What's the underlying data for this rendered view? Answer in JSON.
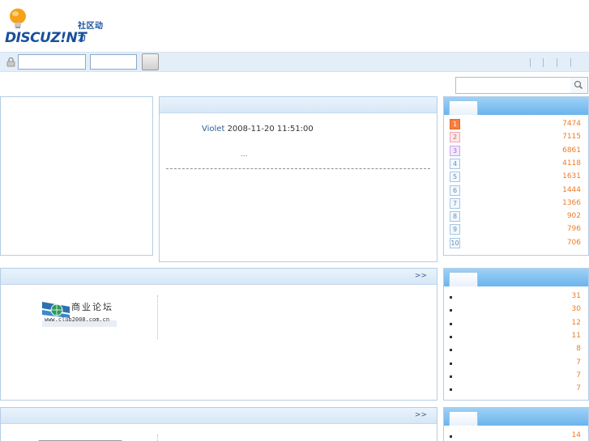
{
  "brand": {
    "logo_cn": "社区动力",
    "logo_en": "DISCUZ!NT"
  },
  "search": {
    "icon": "search-icon"
  },
  "latest_post": {
    "author": "Violet",
    "datetime": "2008-11-20 11:51:00",
    "excerpt": "..."
  },
  "section_more": {
    "forums_more": ">>",
    "second_more": ">>"
  },
  "club_logo": {
    "title": "商业论坛",
    "url": "www.club2008.com.cn"
  },
  "top_ranking": [
    {
      "rank": "1",
      "value": "7474"
    },
    {
      "rank": "2",
      "value": "7115"
    },
    {
      "rank": "3",
      "value": "6861"
    },
    {
      "rank": "4",
      "value": "4118"
    },
    {
      "rank": "5",
      "value": "1631"
    },
    {
      "rank": "6",
      "value": "1444"
    },
    {
      "rank": "7",
      "value": "1366"
    },
    {
      "rank": "8",
      "value": "902"
    },
    {
      "rank": "9",
      "value": "796"
    },
    {
      "rank": "10",
      "value": "706"
    }
  ],
  "hot_list": [
    "31",
    "30",
    "12",
    "11",
    "8",
    "7",
    "7",
    "7"
  ],
  "third_list": [
    "14"
  ],
  "colors": {
    "accent_orange": "#f07a25",
    "link_blue": "#2d5d94",
    "panel_border": "#b5cde6"
  }
}
